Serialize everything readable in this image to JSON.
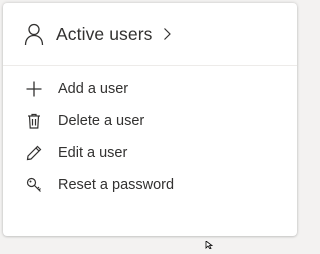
{
  "card": {
    "title": "Active users",
    "title_icon": "person-icon",
    "chevron_icon": "chevron-right-icon"
  },
  "actions": [
    {
      "label": "Add a user",
      "icon": "plus-icon"
    },
    {
      "label": "Delete a user",
      "icon": "trash-icon"
    },
    {
      "label": "Edit a user",
      "icon": "pencil-icon"
    },
    {
      "label": "Reset a password",
      "icon": "key-icon"
    }
  ],
  "colors": {
    "text": "#323130",
    "divider": "#edebe9",
    "background": "#f3f2f1",
    "card": "#ffffff"
  }
}
